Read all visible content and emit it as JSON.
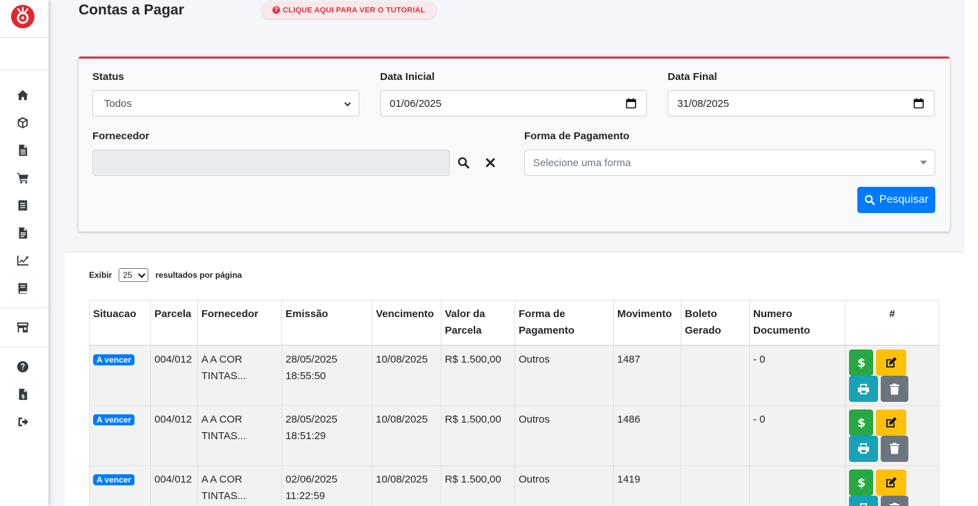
{
  "app": {
    "brand_color": "#e3262d"
  },
  "sidebar": {
    "items": [
      {
        "icon": "home-icon"
      },
      {
        "icon": "box-icon"
      },
      {
        "icon": "file-icon"
      },
      {
        "icon": "cart-icon"
      },
      {
        "icon": "receipt-icon"
      },
      {
        "icon": "document-icon"
      },
      {
        "icon": "chart-line-icon"
      },
      {
        "icon": "book-icon"
      },
      {
        "icon": "store-icon"
      },
      {
        "icon": "help-icon"
      },
      {
        "icon": "invoice-dollar-icon"
      },
      {
        "icon": "logout-icon"
      }
    ]
  },
  "header": {
    "title": "Contas a Pagar",
    "tutorial_label": "CLIQUE AQUI PARA VER O TUTORIAL"
  },
  "filters": {
    "status_label": "Status",
    "status_value": "Todos",
    "start_date_label": "Data Inicial",
    "start_date_value": "01/06/2025",
    "end_date_label": "Data Final",
    "end_date_value": "31/08/2025",
    "supplier_label": "Fornecedor",
    "supplier_value": "",
    "payment_label": "Forma de Pagamento",
    "payment_placeholder": "Selecione uma forma",
    "search_button": "Pesquisar"
  },
  "results": {
    "show_label": "Exibir",
    "page_size": "25",
    "per_page_label": "resultados por página",
    "columns": [
      "Situacao",
      "Parcela",
      "Fornecedor",
      "Emissão",
      "Vencimento",
      "Valor da Parcela",
      "Forma de Pagamento",
      "Movimento",
      "Boleto Gerado",
      "Numero Documento",
      "#"
    ],
    "rows": [
      {
        "status": "A vencer",
        "parcela": "004/012",
        "fornecedor": "A A COR TINTAS...",
        "emissao": "28/05/2025 18:55:50",
        "vencimento": "10/08/2025",
        "valor": "R$ 1.500,00",
        "forma": "Outros",
        "movimento": "1487",
        "boleto": "",
        "documento": "- 0"
      },
      {
        "status": "A vencer",
        "parcela": "004/012",
        "fornecedor": "A A COR TINTAS...",
        "emissao": "28/05/2025 18:51:29",
        "vencimento": "10/08/2025",
        "valor": "R$ 1.500,00",
        "forma": "Outros",
        "movimento": "1486",
        "boleto": "",
        "documento": "- 0"
      },
      {
        "status": "A vencer",
        "parcela": "004/012",
        "fornecedor": "A A COR TINTAS...",
        "emissao": "02/06/2025 11:22:59",
        "vencimento": "10/08/2025",
        "valor": "R$ 1.500,00",
        "forma": "Outros",
        "movimento": "1419",
        "boleto": "",
        "documento": ""
      }
    ]
  }
}
